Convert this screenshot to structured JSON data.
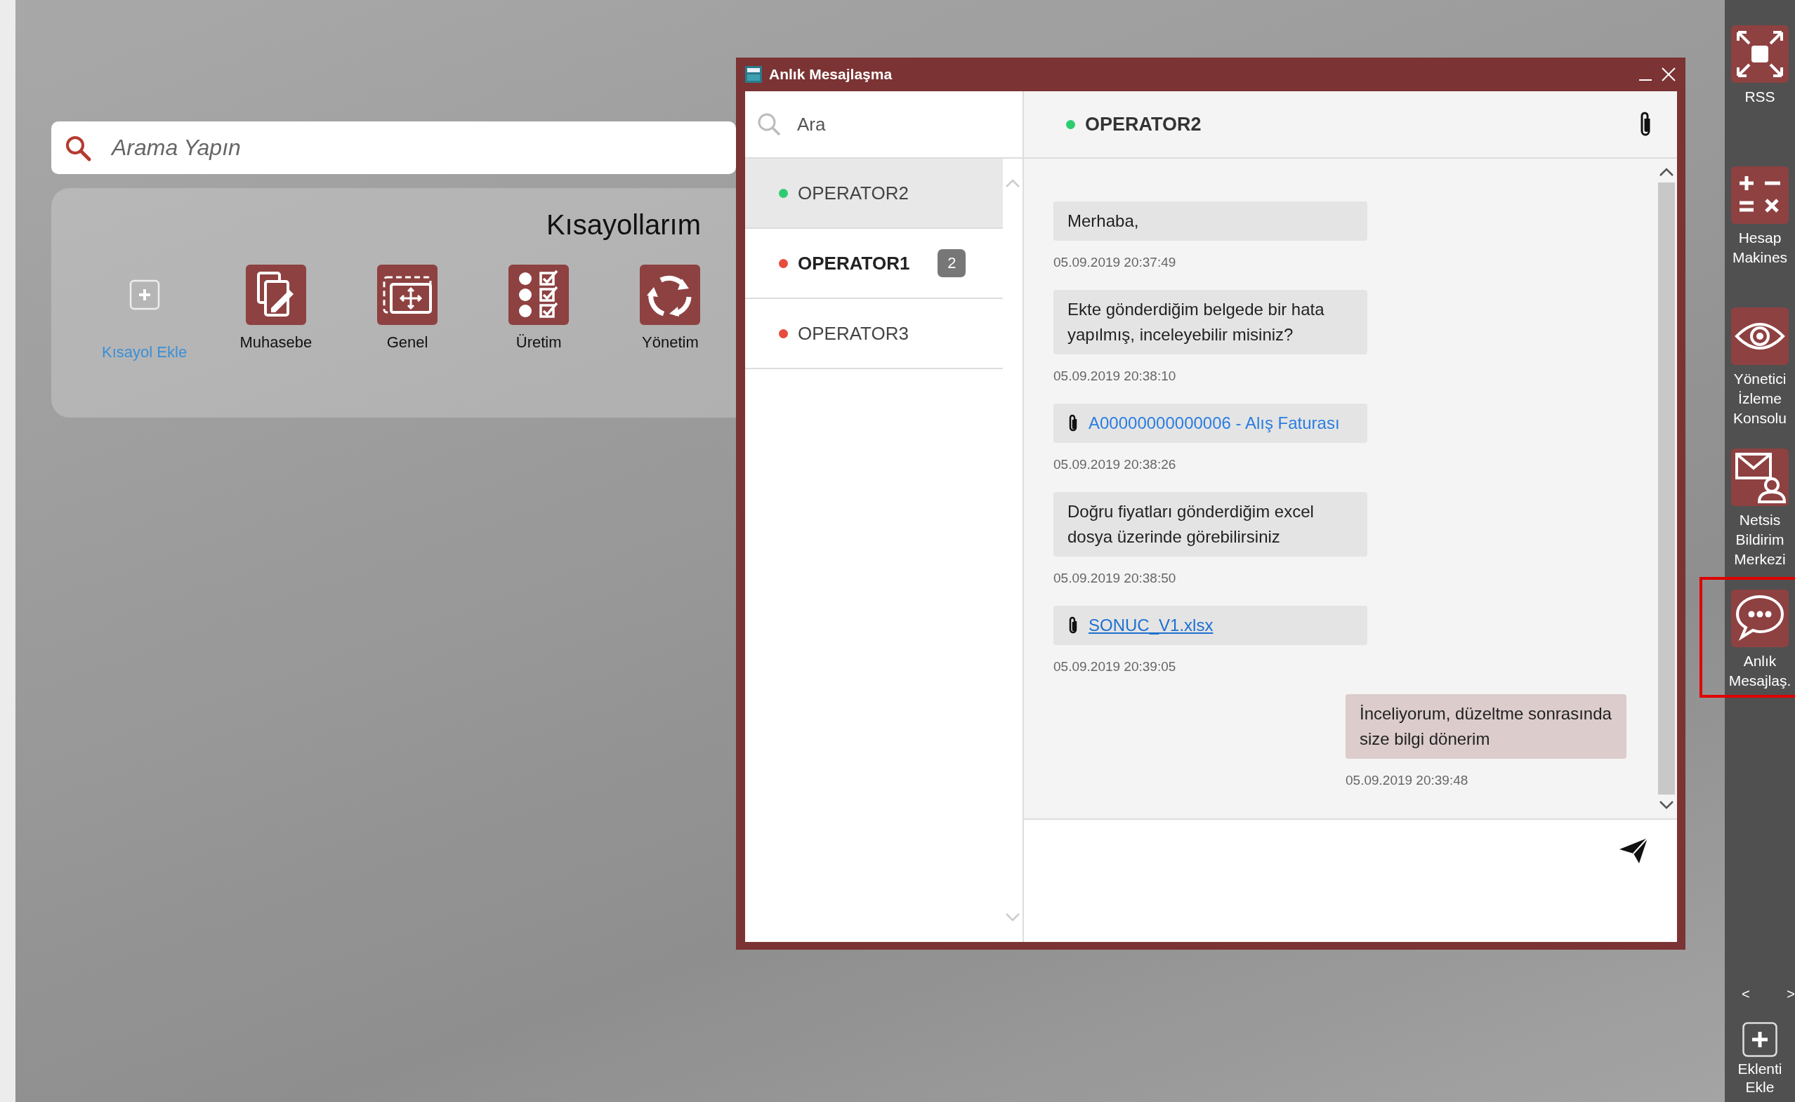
{
  "search": {
    "placeholder": "Arama Yapın"
  },
  "shortcuts": {
    "title": "Kısayollarım",
    "items": [
      {
        "kind": "add",
        "label": "Kısayol Ekle"
      },
      {
        "kind": "document",
        "label": "Muhasebe"
      },
      {
        "kind": "move",
        "label": "Genel"
      },
      {
        "kind": "checklist",
        "label": "Üretim"
      },
      {
        "kind": "cycle",
        "label": "Yönetim"
      }
    ]
  },
  "chat_window": {
    "title": "Anlık Mesajlaşma",
    "search": {
      "placeholder": "Ara"
    },
    "contacts": [
      {
        "name": "OPERATOR2",
        "color": "#2ecc71",
        "selected": true,
        "unread": false
      },
      {
        "name": "OPERATOR1",
        "color": "#e74c3c",
        "selected": false,
        "unread": true,
        "badge": "2"
      },
      {
        "name": "OPERATOR3",
        "color": "#e74c3c",
        "selected": false,
        "unread": false
      }
    ],
    "conversation": {
      "name": "OPERATOR2",
      "color": "#2ecc71",
      "messages": [
        {
          "kind": "text",
          "outgoing": false,
          "text": "Merhaba,",
          "time": "05.09.2019 20:37:49"
        },
        {
          "kind": "text",
          "outgoing": false,
          "text": "Ekte gönderdiğim belgede bir hata yapılmış, inceleyebilir misiniz?",
          "time": "05.09.2019 20:38:10"
        },
        {
          "kind": "attachment",
          "outgoing": false,
          "text": "A00000000000006 - Alış Faturası",
          "underlined": false,
          "time": "05.09.2019 20:38:26"
        },
        {
          "kind": "text",
          "outgoing": false,
          "text": "Doğru fiyatları gönderdiğim excel dosya üzerinde görebilirsiniz",
          "time": "05.09.2019 20:38:50"
        },
        {
          "kind": "attachment",
          "outgoing": false,
          "text": "SONUC_V1.xlsx",
          "underlined": true,
          "time": "05.09.2019 20:39:05"
        },
        {
          "kind": "text",
          "outgoing": true,
          "text": "İnceliyorum, düzeltme sonrasında size bilgi dönerim",
          "time": "05.09.2019 20:39:48"
        }
      ]
    }
  },
  "sidebar": {
    "items": [
      {
        "kind": "expand",
        "label": "RSS",
        "highlighted": false
      },
      {
        "kind": "calculator",
        "label": "Hesap Makines",
        "highlighted": false
      },
      {
        "kind": "eye",
        "label": "Yönetici İzleme Konsolu",
        "highlighted": false
      },
      {
        "kind": "mail-person",
        "label": "Netsis Bildirim Merkezi",
        "highlighted": false
      },
      {
        "kind": "chat",
        "label": "Anlık Mesajlaş.",
        "highlighted": true
      }
    ],
    "prev": "<",
    "next": ">",
    "add_label": "Eklenti Ekle"
  }
}
